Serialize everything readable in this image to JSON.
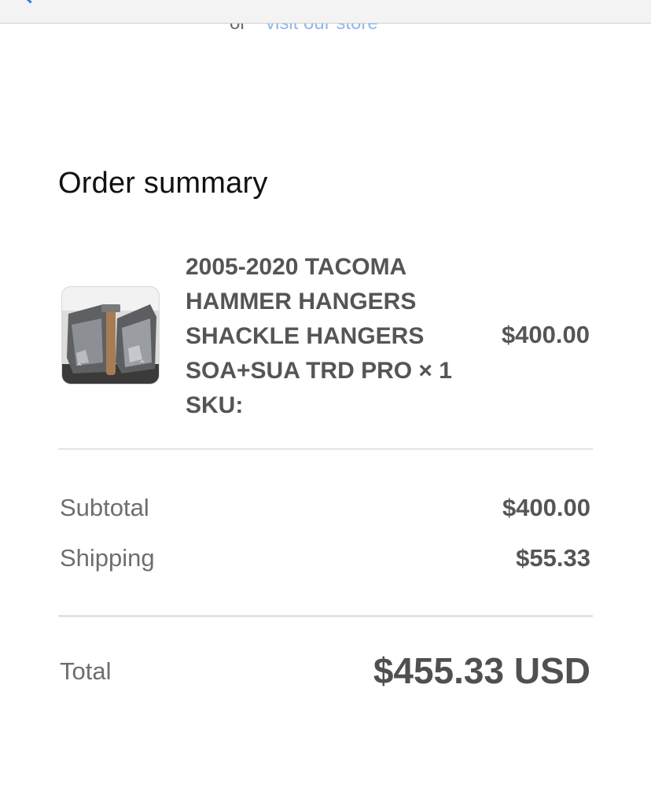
{
  "top_nav": {
    "back_icon": "chevron-left-icon",
    "back_link_color": "#2f7de1"
  },
  "partial_row": {
    "prefix": "or",
    "link": "visit our store"
  },
  "order_summary": {
    "title": "Order summary",
    "item": {
      "image_icon": "product-thumbnail",
      "name_lines": [
        "2005-2020 TACOMA",
        "HAMMER HANGERS",
        "SHACKLE HANGERS",
        "SOA+SUA TRD PRO × 1",
        "SKU:"
      ],
      "price": "$400.00"
    },
    "subtotal_label": "Subtotal",
    "subtotal_value": "$400.00",
    "shipping_label": "Shipping",
    "shipping_value": "$55.33",
    "total_label": "Total",
    "total_value": "$455.33 USD"
  }
}
